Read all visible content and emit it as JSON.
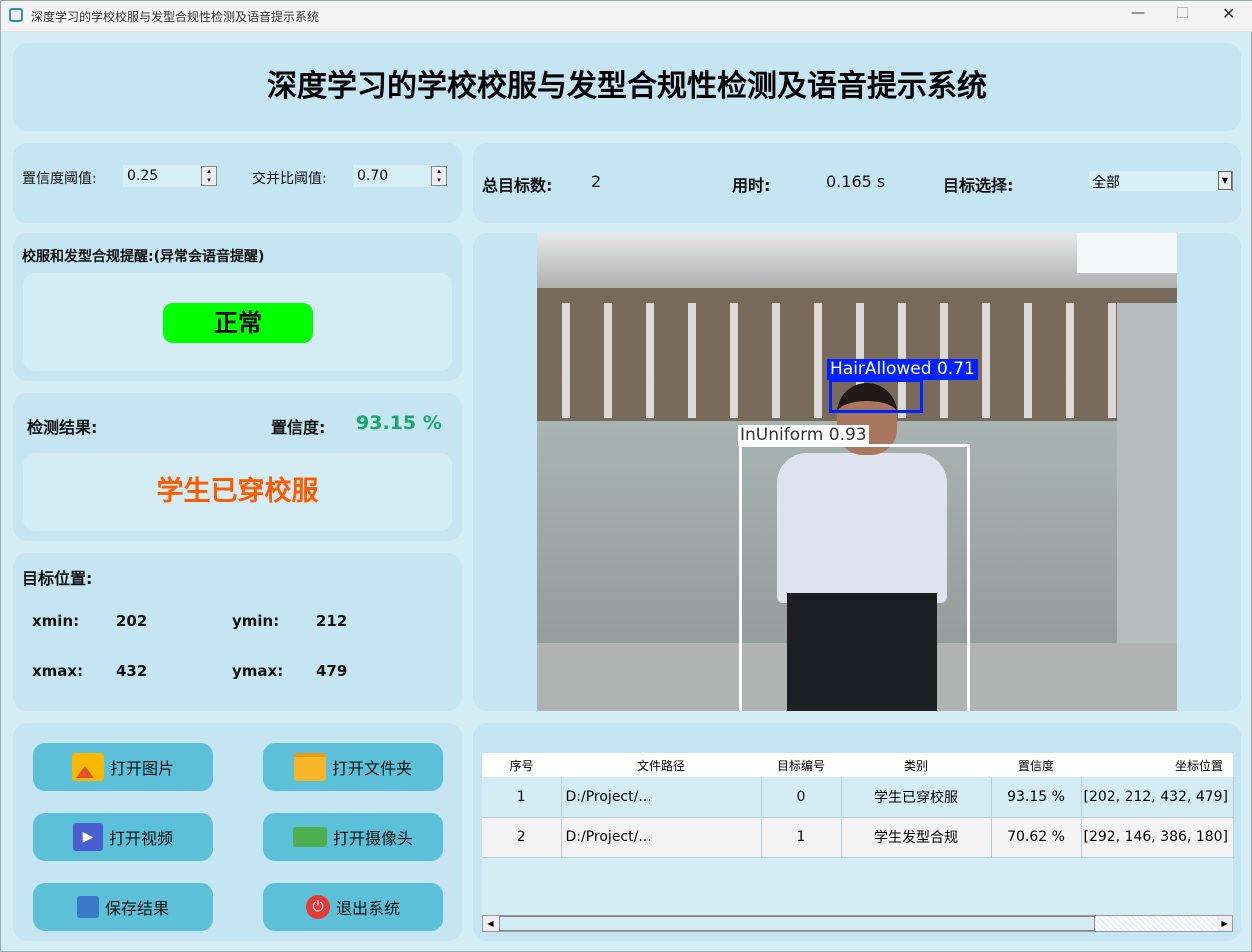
{
  "window": {
    "title": "深度学习的学校校服与发型合规性检测及语音提示系统",
    "app_icon": "shirt-icon"
  },
  "header": {
    "title": "深度学习的学校校服与发型合规性检测及语音提示系统"
  },
  "params": {
    "conf_label": "置信度阈值:",
    "conf_value": "0.25",
    "iou_label": "交并比阈值:",
    "iou_value": "0.70"
  },
  "stats": {
    "total_label": "总目标数:",
    "total_value": "2",
    "time_label": "用时:",
    "time_value": "0.165 s",
    "select_label": "目标选择:",
    "select_value": "全部"
  },
  "alert": {
    "title": "校服和发型合规提醒:(异常会语音提醒)",
    "status": "正常",
    "status_color": "#00ff00"
  },
  "result": {
    "label": "检测结果:",
    "conf_label": "置信度:",
    "conf_value": "93.15 %",
    "class_text": "学生已穿校服",
    "class_color": "#ff5a00"
  },
  "position": {
    "title": "目标位置:",
    "xmin_label": "xmin:",
    "xmin": "202",
    "ymin_label": "ymin:",
    "ymin": "212",
    "xmax_label": "xmax:",
    "xmax": "432",
    "ymax_label": "ymax:",
    "ymax": "479"
  },
  "buttons": [
    {
      "label": "打开图片",
      "icon": "image-icon"
    },
    {
      "label": "打开文件夹",
      "icon": "folder-icon"
    },
    {
      "label": "打开视频",
      "icon": "video-icon"
    },
    {
      "label": "打开摄像头",
      "icon": "camera-icon"
    },
    {
      "label": "保存结果",
      "icon": "save-icon"
    },
    {
      "label": "退出系统",
      "icon": "power-icon"
    }
  ],
  "image": {
    "detections": [
      {
        "label": "HairAllowed 0.71",
        "color": "#0022ff"
      },
      {
        "label": "InUniform 0.93",
        "color": "#ffffff"
      }
    ]
  },
  "table": {
    "columns": [
      "序号",
      "文件路径",
      "目标编号",
      "类别",
      "置信度",
      "坐标位置"
    ],
    "rows": [
      [
        "1",
        "D:/Project/...",
        "0",
        "学生已穿校服",
        "93.15 %",
        "[202, 212, 432, 479]"
      ],
      [
        "2",
        "D:/Project/...",
        "1",
        "学生发型合规",
        "70.62 %",
        "[292, 146, 386, 180]"
      ]
    ]
  }
}
